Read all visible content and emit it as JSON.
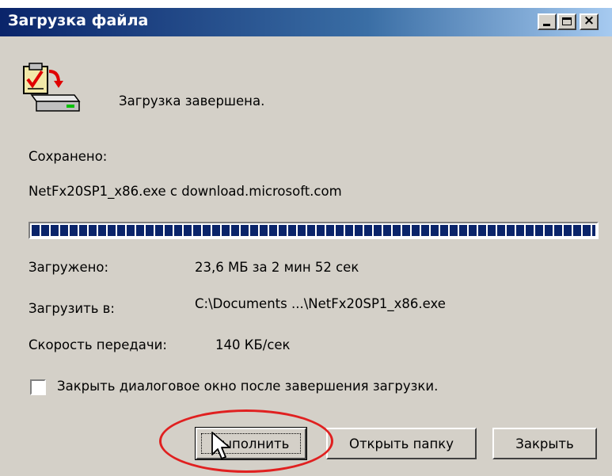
{
  "window": {
    "title": "Загрузка файла"
  },
  "status": {
    "message": "Загрузка завершена."
  },
  "saved": {
    "label": "Сохранено:",
    "file_info": "NetFx20SP1_x86.exe с download.microsoft.com"
  },
  "progress": {
    "fraction": 1.0
  },
  "details": {
    "downloaded_label": "Загружено:",
    "downloaded_value": "23,6 МБ за 2 мин 52 сек",
    "download_to_label": "Загрузить в:",
    "download_to_value": "C:\\Documents ...\\NetFx20SP1_x86.exe",
    "speed_label": "Скорость передачи:",
    "speed_value": "140 КБ/сек"
  },
  "options": {
    "close_on_complete_label": "Закрыть диалоговое окно после завершения загрузки.",
    "close_on_complete_checked": false
  },
  "buttons": {
    "run": "Выполнить",
    "open_folder": "Открыть папку",
    "close": "Закрыть"
  },
  "titlebar_buttons": {
    "close_glyph": "×"
  },
  "icons": {
    "download": "download-complete-icon",
    "cursor": "mouse-pointer-icon"
  },
  "colors": {
    "titlebar": "#0a246a",
    "dialog_face": "#d4d0c8",
    "progress_block": "#0a246a",
    "annotation": "#e02020"
  }
}
